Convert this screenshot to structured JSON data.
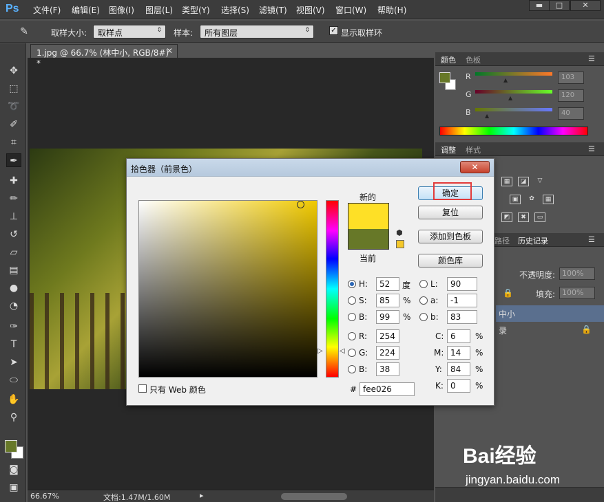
{
  "app": {
    "logo": "Ps"
  },
  "menu": [
    "文件(F)",
    "编辑(E)",
    "图像(I)",
    "图层(L)",
    "类型(Y)",
    "选择(S)",
    "滤镜(T)",
    "视图(V)",
    "窗口(W)",
    "帮助(H)"
  ],
  "options": {
    "sample_size_label": "取样大小:",
    "sample_size_value": "取样点",
    "sample_label": "样本:",
    "sample_value": "所有图层",
    "show_ring_label": "显示取样环",
    "show_ring_checked": true
  },
  "document": {
    "tab_title": "1.jpg @ 66.7% (林中小, RGB/8#) *",
    "zoom": "66.67%",
    "doc_size": "文档:1.47M/1.60M"
  },
  "panels": {
    "color_tab": "颜色",
    "swatches_tab": "色板",
    "rgb": {
      "r": "103",
      "g": "120",
      "b": "40"
    },
    "adjust_tab": "调整",
    "styles_tab": "样式",
    "paths_tab_partial": "路径",
    "history_tab": "历史记录",
    "opacity_label": "不透明度:",
    "opacity_value": "100%",
    "fill_label": "填充:",
    "fill_value": "100%",
    "layer1_name": "中小",
    "layer2_name": "录"
  },
  "color_picker": {
    "title": "拾色器（前景色）",
    "new_label": "新的",
    "current_label": "当前",
    "new_color": "#fee026",
    "current_color": "#677828",
    "buttons": {
      "ok": "确定",
      "reset": "复位",
      "add_swatch": "添加到色板",
      "libraries": "颜色库"
    },
    "hsb": {
      "h": "52",
      "h_unit": "度",
      "s": "85",
      "s_unit": "%",
      "b": "99",
      "b_unit": "%"
    },
    "lab": {
      "l": "90",
      "a": "-1",
      "b": "83"
    },
    "rgb": {
      "r": "254",
      "g": "224",
      "b": "38"
    },
    "cmyk": {
      "c": "6",
      "m": "14",
      "y": "84",
      "k": "0",
      "unit": "%"
    },
    "hex_label": "#",
    "hex": "fee026",
    "web_only_label": "只有 Web 颜色",
    "web_only_checked": false
  },
  "watermark": {
    "logo": "Bai经验",
    "url": "jingyan.baidu.com"
  }
}
